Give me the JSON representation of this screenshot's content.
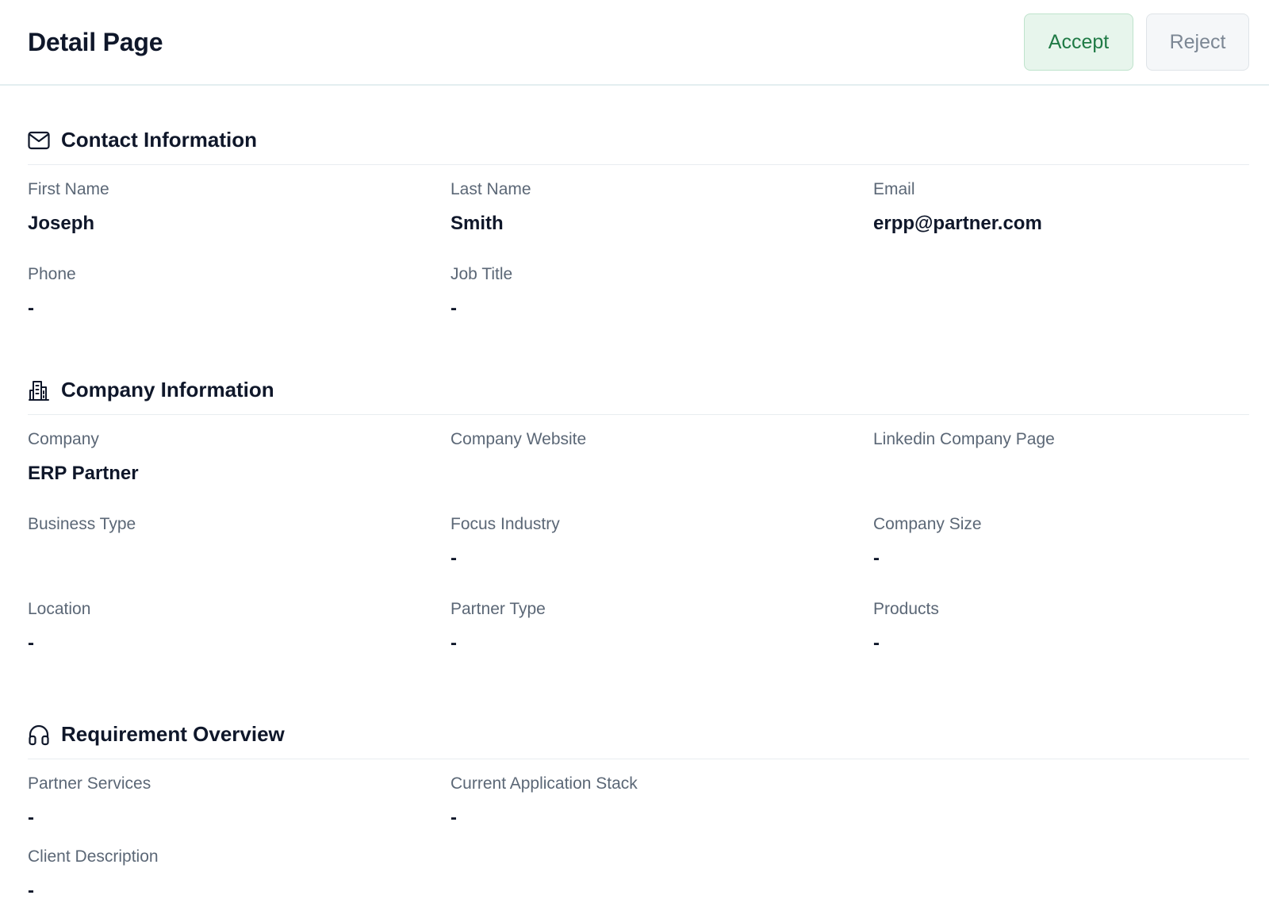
{
  "header": {
    "title": "Detail Page",
    "accept_label": "Accept",
    "reject_label": "Reject"
  },
  "sections": {
    "contact": {
      "title": "Contact Information",
      "icon": "mail-icon",
      "fields": [
        {
          "label": "First Name",
          "value": "Joseph"
        },
        {
          "label": "Last Name",
          "value": "Smith"
        },
        {
          "label": "Email",
          "value": "erpp@partner.com"
        },
        {
          "label": "Phone",
          "value": "-"
        },
        {
          "label": "Job Title",
          "value": "-"
        }
      ]
    },
    "company": {
      "title": "Company Information",
      "icon": "building-icon",
      "fields": [
        {
          "label": "Company",
          "value": "ERP Partner"
        },
        {
          "label": "Company Website",
          "value": ""
        },
        {
          "label": "Linkedin Company Page",
          "value": ""
        },
        {
          "label": "Business Type",
          "value": ""
        },
        {
          "label": "Focus Industry",
          "value": "-"
        },
        {
          "label": "Company Size",
          "value": "-"
        },
        {
          "label": "Location",
          "value": "-"
        },
        {
          "label": "Partner Type",
          "value": "-"
        },
        {
          "label": "Products",
          "value": "-"
        }
      ]
    },
    "requirement": {
      "title": "Requirement Overview",
      "icon": "headphones-icon",
      "fields": [
        {
          "label": "Partner Services",
          "value": "-"
        },
        {
          "label": "Current Application Stack",
          "value": "-"
        },
        {
          "label": "Client Description",
          "value": "-"
        }
      ]
    }
  },
  "colors": {
    "accept_bg": "#e7f5ec",
    "accept_text": "#1f7a45",
    "reject_bg": "#f5f7f9",
    "reject_text": "#7c8794"
  }
}
